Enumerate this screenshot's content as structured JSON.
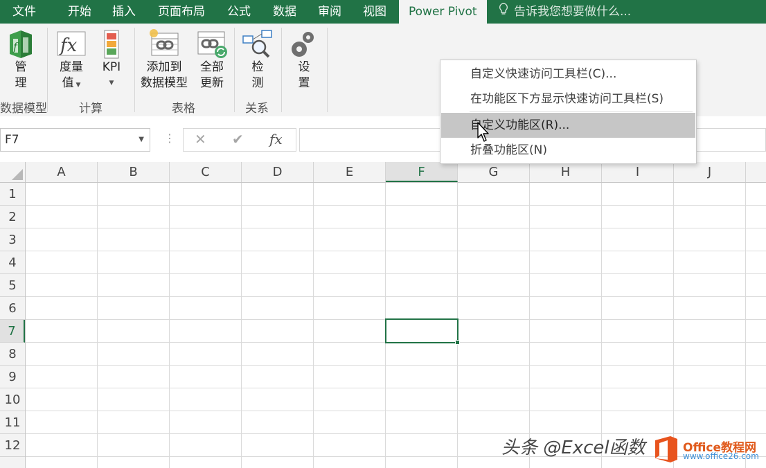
{
  "tabs": [
    {
      "label": "文件"
    },
    {
      "label": "开始"
    },
    {
      "label": "插入"
    },
    {
      "label": "页面布局"
    },
    {
      "label": "公式"
    },
    {
      "label": "数据"
    },
    {
      "label": "审阅"
    },
    {
      "label": "视图"
    },
    {
      "label": "Power Pivot",
      "active": true
    }
  ],
  "tell_me": "告诉我您想要做什么...",
  "ribbon": {
    "groups": {
      "data_model": {
        "label": "数据模型",
        "manage_line1": "管",
        "manage_line2": "理"
      },
      "calc": {
        "label": "计算",
        "measures_line1": "度量",
        "measures_line2": "值",
        "kpi": "KPI"
      },
      "tables": {
        "label": "表格",
        "add_line1": "添加到",
        "add_line2": "数据模型",
        "refresh_line1": "全部",
        "refresh_line2": "更新"
      },
      "relationships": {
        "label": "关系",
        "detect_line1": "检",
        "detect_line2": "测"
      },
      "settings": {
        "line1": "设",
        "line2": "置"
      }
    }
  },
  "formula_bar": {
    "name_box": "F7",
    "fx": "fx"
  },
  "columns": [
    "A",
    "B",
    "C",
    "D",
    "E",
    "F",
    "G",
    "H",
    "I",
    "J"
  ],
  "rows": [
    "1",
    "2",
    "3",
    "4",
    "5",
    "6",
    "7",
    "8",
    "9",
    "10",
    "11",
    "12"
  ],
  "selected_cell": {
    "column": "F",
    "row": "7"
  },
  "context_menu": {
    "items": [
      "自定义快速访问工具栏(C)...",
      "在功能区下方显示快速访问工具栏(S)",
      "自定义功能区(R)...",
      "折叠功能区(N)"
    ],
    "highlighted_index": 2
  },
  "watermark": {
    "text": "头条 @Excel函数",
    "site_name": "Office教程网",
    "site_url": "www.office26.com"
  },
  "colors": {
    "accent": "#217346",
    "ribbon_bg": "#f3f3f3",
    "menu_highlight": "#c6c6c6"
  }
}
